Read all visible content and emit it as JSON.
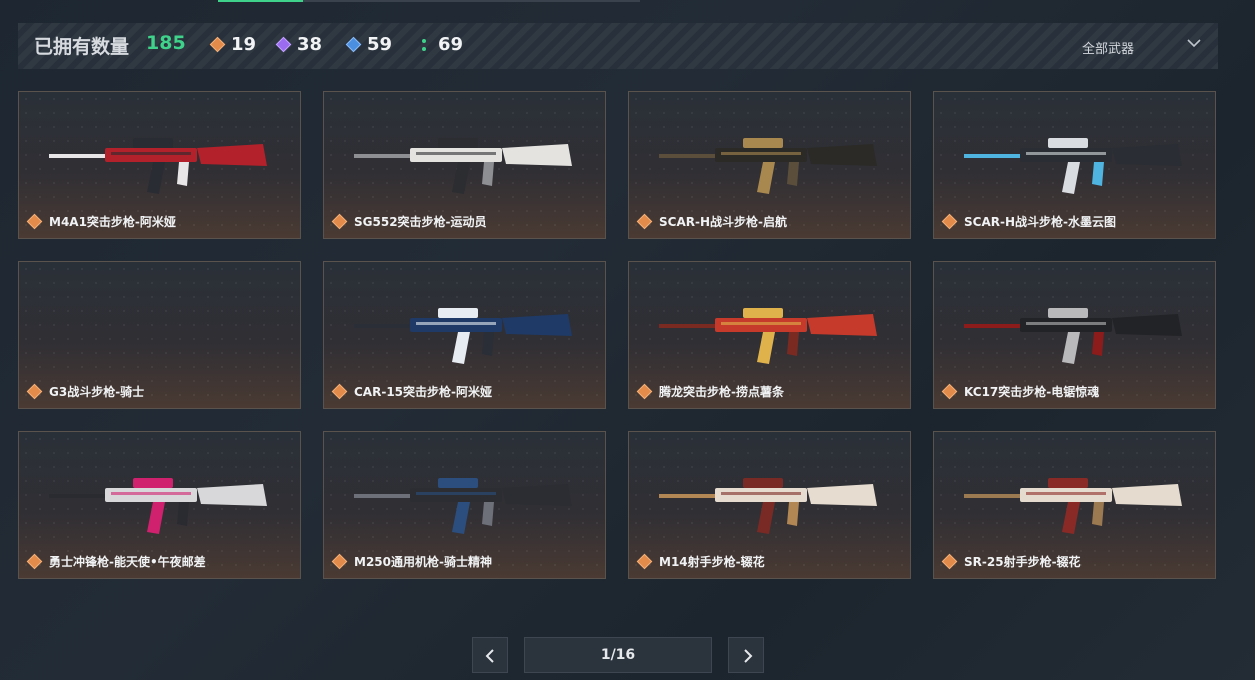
{
  "header": {
    "owned_label": "已拥有数量",
    "owned_count": "185",
    "tiers": [
      {
        "icon": "orange-diamond-icon",
        "color": "#e38b4a",
        "count": "19"
      },
      {
        "icon": "purple-diamond-icon",
        "color": "#9b6cf0",
        "count": "38"
      },
      {
        "icon": "blue-diamond-icon",
        "color": "#4b8fe0",
        "count": "59"
      },
      {
        "icon": "green-dots-icon",
        "color": "#3fd28a",
        "count": "69"
      }
    ],
    "filter_label": "全部武器"
  },
  "weapons": [
    {
      "name": "M4A1突击步枪-阿米娅",
      "palette": [
        "#b3212a",
        "#2a2c33",
        "#e8e6e6"
      ]
    },
    {
      "name": "SG552突击步枪-运动员",
      "palette": [
        "#e5e3e0",
        "#2b2d31",
        "#8d8f93"
      ]
    },
    {
      "name": "SCAR-H战斗步枪-启航",
      "palette": [
        "#2b2a27",
        "#a8884e",
        "#5b4f3c"
      ]
    },
    {
      "name": "SCAR-H战斗步枪-水墨云图",
      "palette": [
        "#2a2d33",
        "#d9dde2",
        "#4fb4e0"
      ]
    },
    {
      "name": "G3战斗步枪-骑士",
      "palette": []
    },
    {
      "name": "CAR-15突击步枪-阿米娅",
      "palette": [
        "#1f3a66",
        "#e7ecf2",
        "#2a2e36"
      ]
    },
    {
      "name": "腾龙突击步枪-捞点薯条",
      "palette": [
        "#c63a2c",
        "#e0b24c",
        "#7b2a22"
      ]
    },
    {
      "name": "KC17突击步枪-电锯惊魂",
      "palette": [
        "#222326",
        "#b9b9bb",
        "#8c1b1b"
      ]
    },
    {
      "name": "勇士冲锋枪-能天使•午夜邮差",
      "palette": [
        "#d8d8da",
        "#d0216e",
        "#2a2b31"
      ]
    },
    {
      "name": "M250通用机枪-骑士精神",
      "palette": [
        "#2b2d33",
        "#2c4e7e",
        "#6d7079"
      ]
    },
    {
      "name": "M14射手步枪-辍花",
      "palette": [
        "#e7dcd0",
        "#7a2a25",
        "#b28754"
      ]
    },
    {
      "name": "SR-25射手步枪-辍花",
      "palette": [
        "#e5dbcf",
        "#8a2a27",
        "#9c7a51"
      ]
    }
  ],
  "pagination": {
    "current": "1/16"
  }
}
